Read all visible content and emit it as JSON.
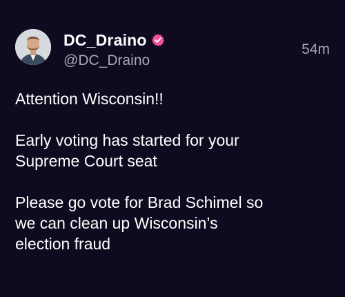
{
  "author": {
    "display_name": "DC_Draino",
    "handle": "@DC_Draino",
    "verified": true,
    "verified_color": "#f2509a"
  },
  "post": {
    "timestamp": "54m",
    "paragraphs": [
      [
        "Attention Wisconsin!!"
      ],
      [
        "Early voting has started for your",
        "Supreme Court seat"
      ],
      [
        "Please go vote for Brad Schimel so",
        "we can clean up Wisconsin’s",
        "election fraud"
      ]
    ]
  },
  "colors": {
    "background": "#0f0a1f",
    "text": "#ffffff",
    "muted": "#a9a6b4"
  }
}
